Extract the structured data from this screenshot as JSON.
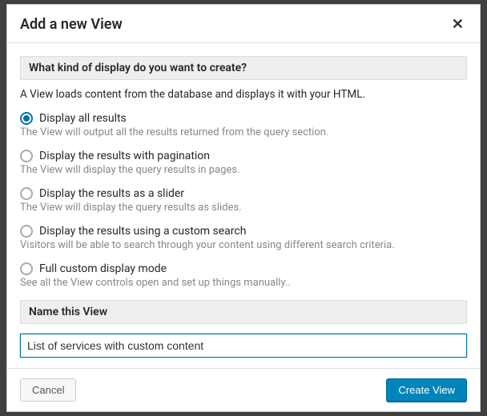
{
  "modal": {
    "title": "Add a new View",
    "close_label": "✕"
  },
  "section1": {
    "heading": "What kind of display do you want to create?",
    "intro": "A View loads content from the database and displays it with your HTML."
  },
  "options": [
    {
      "label": "Display all results",
      "desc": "The View will output all the results returned from the query section.",
      "selected": true
    },
    {
      "label": "Display the results with pagination",
      "desc": "The View will display the query results in pages.",
      "selected": false
    },
    {
      "label": "Display the results as a slider",
      "desc": "The View will display the query results as slides.",
      "selected": false
    },
    {
      "label": "Display the results using a custom search",
      "desc": "Visitors will be able to search through your content using different search criteria.",
      "selected": false
    },
    {
      "label": "Full custom display mode",
      "desc": "See all the View controls open and set up things manually..",
      "selected": false
    }
  ],
  "section2": {
    "heading": "Name this View",
    "value": "List of services with custom content"
  },
  "footer": {
    "cancel_label": "Cancel",
    "create_label": "Create View"
  }
}
